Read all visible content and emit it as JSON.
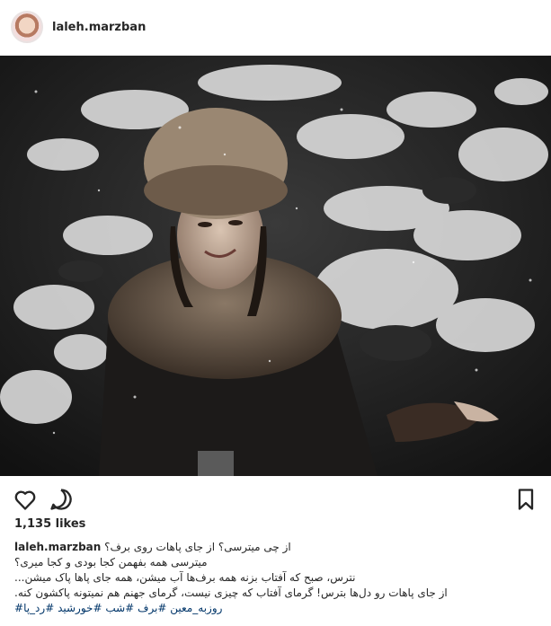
{
  "post": {
    "username": "laleh.marzban",
    "likes": "1,135 likes",
    "caption_user": "laleh.marzban",
    "caption_lines": [
      "از چی میترسی؟ از جای پاهات روی برف؟",
      "میترسی همه بفهمن کجا بودی و کجا میری؟",
      "...نترس، صبح که آفتاب بزنه همه برف‌ها آب میشن، همه جای پاها پاک میشن",
      ".از جای پاهات رو دل‌ها بترس! گرمای آفتاب که چیزی نیست، گرمای جهنم هم نمیتونه پاکشون کنه"
    ],
    "hashtags": "#روزبه_معین #برف #شب #خورشید #رد_پا"
  },
  "icons": {
    "like": "heart-icon",
    "comment": "comment-icon",
    "save": "bookmark-icon"
  }
}
